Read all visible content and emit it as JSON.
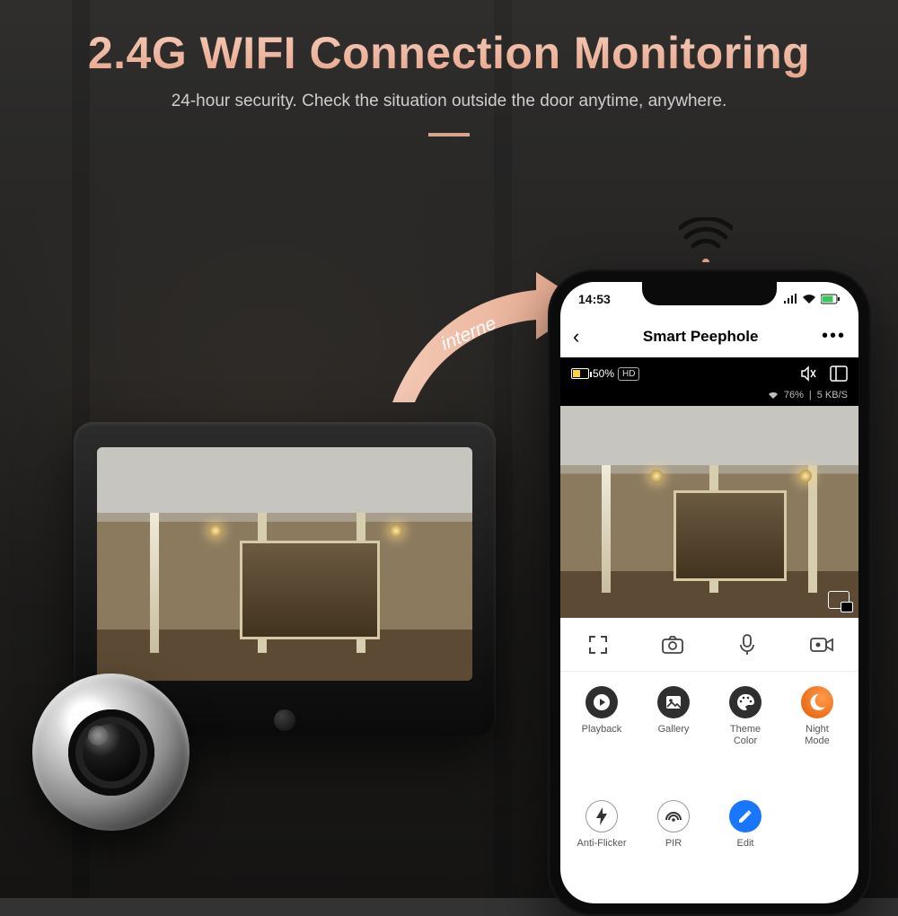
{
  "hero": {
    "title": "2.4G WIFI Connection Monitoring",
    "subtitle": "24-hour security. Check the situation outside the door anytime, anywhere."
  },
  "arrow_label": "interne",
  "phone": {
    "status": {
      "time": "14:53"
    },
    "app_title": "Smart Peephole",
    "overlay": {
      "battery_pct": "50%",
      "hd": "HD",
      "signal_pct": "76%",
      "bitrate": "5 KB/S"
    },
    "grid": [
      {
        "key": "playback",
        "label": "Playback",
        "color": "c-dark"
      },
      {
        "key": "gallery",
        "label": "Gallery",
        "color": "c-dark"
      },
      {
        "key": "theme",
        "label": "Theme\nColor",
        "color": "c-dark"
      },
      {
        "key": "night",
        "label": "Night\nMode",
        "color": "c-orange"
      },
      {
        "key": "antiflicker",
        "label": "Anti-Flicker",
        "color": "c-white"
      },
      {
        "key": "pir",
        "label": "PIR",
        "color": "c-white"
      },
      {
        "key": "edit",
        "label": "Edit",
        "color": "c-blue"
      }
    ]
  }
}
